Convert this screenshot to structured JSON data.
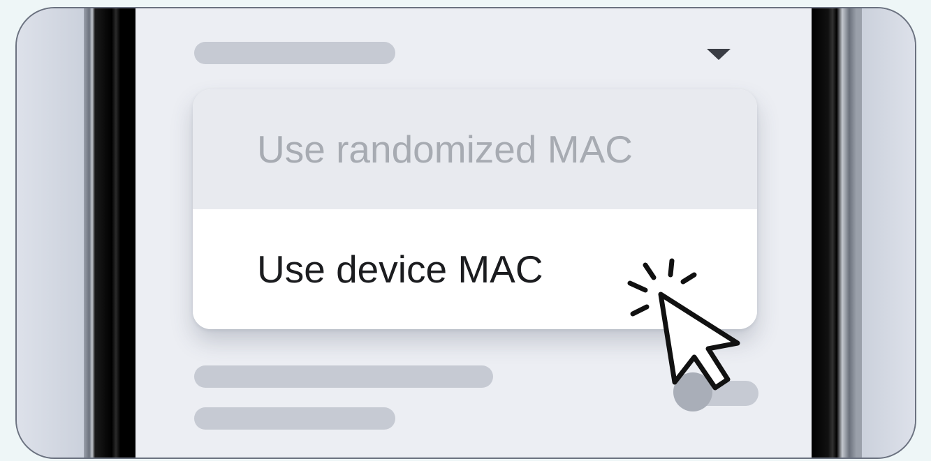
{
  "menu": {
    "items": [
      {
        "label": "Use randomized MAC",
        "state": "disabled"
      },
      {
        "label": "Use device MAC",
        "state": "hovered"
      }
    ]
  },
  "toggle": {
    "state": "off"
  },
  "icons": {
    "dropdown": "caret-down-icon",
    "pointer": "mouse-pointer-click-icon"
  },
  "colors": {
    "screen_bg": "#eceef3",
    "menu_bg": "#ffffff",
    "disabled_text": "#a7abb2",
    "active_text": "#1b1c1f",
    "placeholder": "#c6cad3"
  }
}
